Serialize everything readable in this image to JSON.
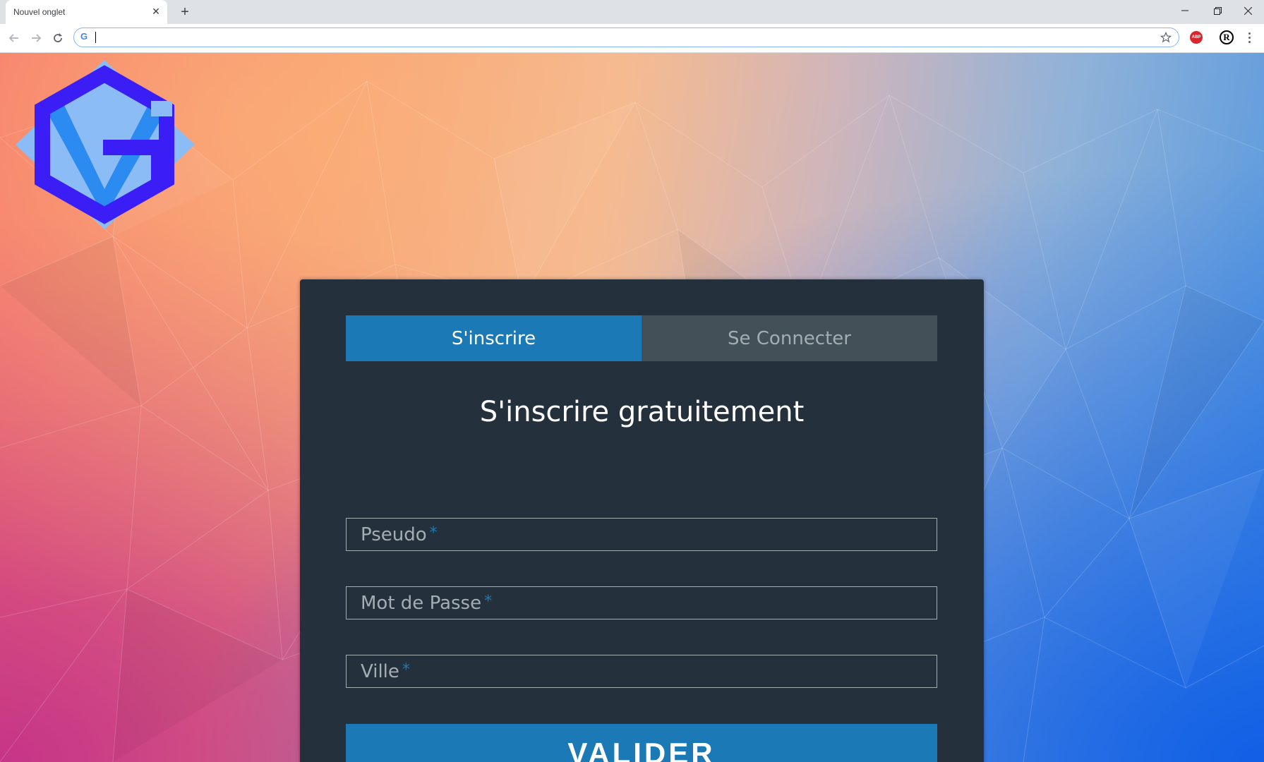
{
  "browser": {
    "tab_title": "Nouvel onglet",
    "omnibox_value": "",
    "icons": {
      "tab_close": "close-icon",
      "new_tab": "plus-icon",
      "back": "back-arrow-icon",
      "forward": "forward-arrow-icon",
      "reload": "reload-icon",
      "search_engine": "google-g-icon",
      "bookmark": "star-icon",
      "extension_abp": "adblock-plus-icon",
      "extension_r": "r-extension-icon",
      "menu": "kebab-menu-icon",
      "minimize": "minimize-icon",
      "restore": "restore-icon",
      "close_window": "window-close-icon"
    },
    "omnibox_g": "G",
    "abp_label": "ABP",
    "r_label": "R"
  },
  "form": {
    "tabs": [
      {
        "label": "S'inscrire",
        "active": true
      },
      {
        "label": "Se Connecter",
        "active": false
      }
    ],
    "title": "S'inscrire gratuitement",
    "fields": [
      {
        "placeholder": "Pseudo",
        "required_mark": "*"
      },
      {
        "placeholder": "Mot de Passe",
        "required_mark": "*"
      },
      {
        "placeholder": "Ville",
        "required_mark": "*"
      }
    ],
    "submit_label": "VALIDER"
  },
  "colors": {
    "accent": "#1b7ab5",
    "panel": "#24313c",
    "inactive_tab": "#435058",
    "logo_purple": "#3a1ef5",
    "logo_light": "#8cbcf5"
  }
}
